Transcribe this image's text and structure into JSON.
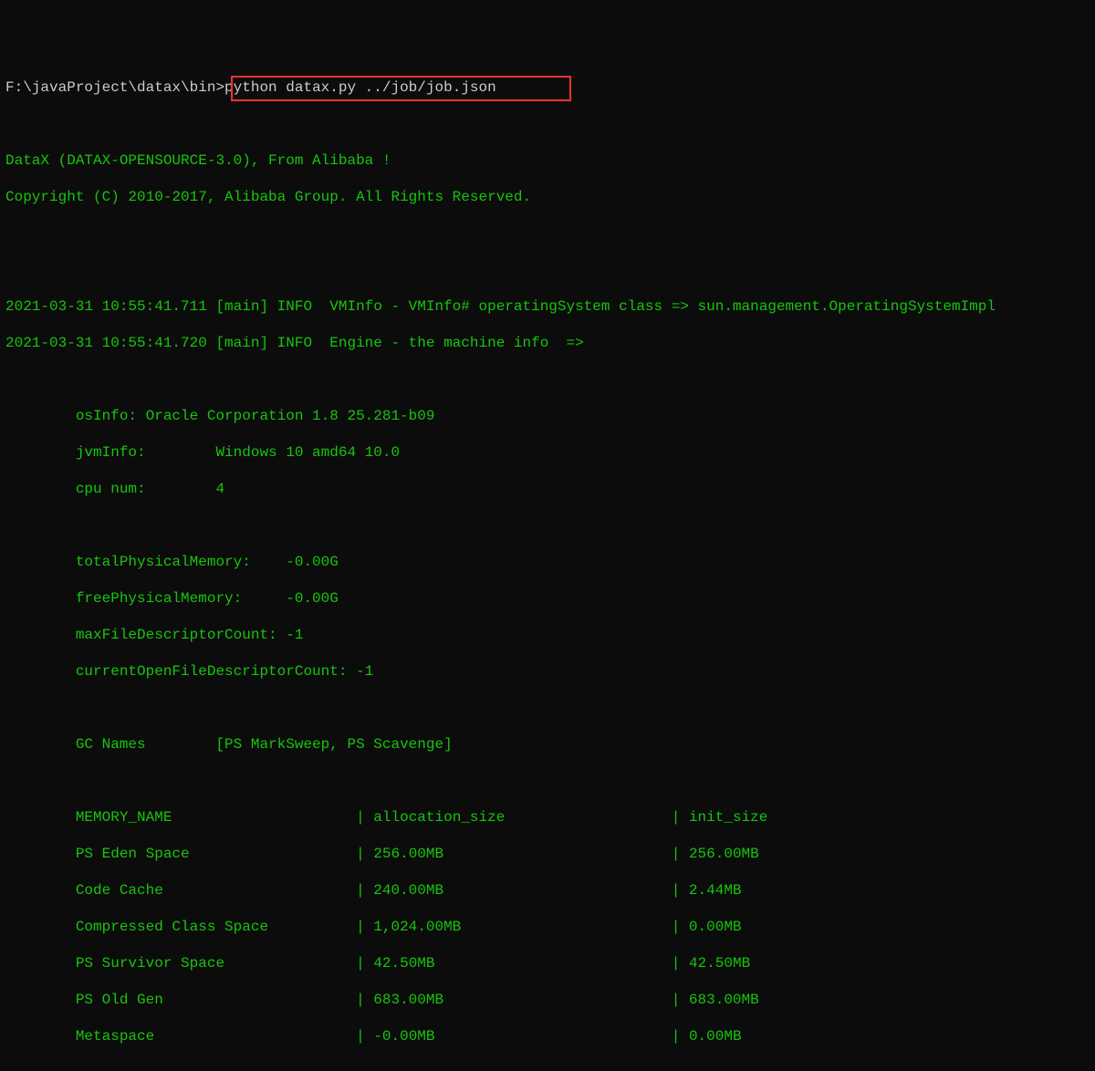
{
  "prompt": {
    "path": "F:\\javaProject\\datax\\bin>",
    "command": "python datax.py ../job/job.json"
  },
  "header": {
    "line1": "DataX (DATAX-OPENSOURCE-3.0), From Alibaba !",
    "line2": "Copyright (C) 2010-2017, Alibaba Group. All Rights Reserved."
  },
  "logs": {
    "log1": "2021-03-31 10:55:41.711 [main] INFO  VMInfo - VMInfo# operatingSystem class => sun.management.OperatingSystemImpl",
    "log2": "2021-03-31 10:55:41.720 [main] INFO  Engine - the machine info  =>"
  },
  "machine_info": {
    "osInfo": "        osInfo: Oracle Corporation 1.8 25.281-b09",
    "jvmInfo": "        jvmInfo:        Windows 10 amd64 10.0",
    "cpuNum": "        cpu num:        4",
    "totalPhysicalMemory": "        totalPhysicalMemory:    -0.00G",
    "freePhysicalMemory": "        freePhysicalMemory:     -0.00G",
    "maxFileDescriptorCount": "        maxFileDescriptorCount: -1",
    "currentOpenFileDescriptorCount": "        currentOpenFileDescriptorCount: -1",
    "gcNames": "        GC Names        [PS MarkSweep, PS Scavenge]"
  },
  "memory_table": {
    "header": {
      "col1": "        MEMORY_NAME",
      "col2": "allocation_size",
      "col3": "init_size"
    },
    "rows": [
      {
        "name": "        PS Eden Space",
        "alloc": "256.00MB",
        "init": "256.00MB"
      },
      {
        "name": "        Code Cache",
        "alloc": "240.00MB",
        "init": "2.44MB"
      },
      {
        "name": "        Compressed Class Space",
        "alloc": "1,024.00MB",
        "init": "0.00MB"
      },
      {
        "name": "        PS Survivor Space",
        "alloc": "42.50MB",
        "init": "42.50MB"
      },
      {
        "name": "        PS Old Gen",
        "alloc": "683.00MB",
        "init": "683.00MB"
      },
      {
        "name": "        Metaspace",
        "alloc": "-0.00MB",
        "init": "0.00MB"
      }
    ]
  }
}
